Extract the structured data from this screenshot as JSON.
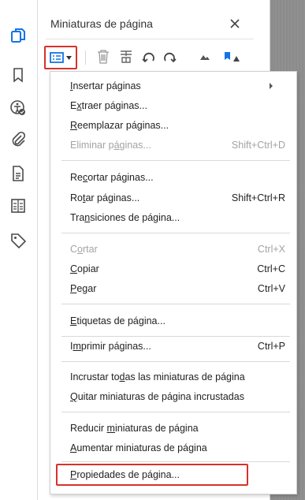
{
  "panel": {
    "title": "Miniaturas de página"
  },
  "rail": {
    "icons": [
      "page-thumbnails-icon",
      "bookmark-icon",
      "accessibility-icon",
      "attachment-icon",
      "document-icon",
      "compare-icon",
      "tag-icon"
    ]
  },
  "toolbar": {
    "icons": [
      "options-icon",
      "chevron-down-icon",
      "trash-icon",
      "insert-pages-icon",
      "rotate-left-icon",
      "rotate-right-icon",
      "small-thumbnail-icon",
      "large-thumbnail-icon"
    ]
  },
  "menu": {
    "items": [
      {
        "label": "Insertar páginas",
        "mnemonic": "I",
        "shortcut": "",
        "enabled": true,
        "submenu": true
      },
      {
        "label": "Extraer páginas...",
        "mnemonic": "x",
        "shortcut": "",
        "enabled": true,
        "submenu": false
      },
      {
        "label": "Reemplazar páginas...",
        "mnemonic": "R",
        "shortcut": "",
        "enabled": true,
        "submenu": false
      },
      {
        "label": "Eliminar páginas...",
        "mnemonic": "á",
        "shortcut": "Shift+Ctrl+D",
        "enabled": false,
        "submenu": false
      },
      {
        "label": "Recortar páginas...",
        "mnemonic": "c",
        "shortcut": "",
        "enabled": true,
        "submenu": false
      },
      {
        "label": "Rotar páginas...",
        "mnemonic": "t",
        "shortcut": "Shift+Ctrl+R",
        "enabled": true,
        "submenu": false
      },
      {
        "label": "Transiciones de página...",
        "mnemonic": "n",
        "shortcut": "",
        "enabled": true,
        "submenu": false
      },
      {
        "label": "Cortar",
        "mnemonic": "o",
        "shortcut": "Ctrl+X",
        "enabled": false,
        "submenu": false
      },
      {
        "label": "Copiar",
        "mnemonic": "C",
        "shortcut": "Ctrl+C",
        "enabled": true,
        "submenu": false
      },
      {
        "label": "Pegar",
        "mnemonic": "P",
        "shortcut": "Ctrl+V",
        "enabled": true,
        "submenu": false
      },
      {
        "label": "Etiquetas de página...",
        "mnemonic": "E",
        "shortcut": "",
        "enabled": true,
        "submenu": false
      },
      {
        "label": "Imprimir páginas...",
        "mnemonic": "m",
        "shortcut": "Ctrl+P",
        "enabled": true,
        "submenu": false
      },
      {
        "label": "Incrustar todas las miniaturas de página",
        "mnemonic": "d",
        "shortcut": "",
        "enabled": true,
        "submenu": false
      },
      {
        "label": "Quitar miniaturas de página incrustadas",
        "mnemonic": "Q",
        "shortcut": "",
        "enabled": true,
        "submenu": false
      },
      {
        "label": "Reducir miniaturas de página",
        "mnemonic": "m",
        "shortcut": "",
        "enabled": true,
        "submenu": false
      },
      {
        "label": "Aumentar miniaturas de página",
        "mnemonic": "A",
        "shortcut": "",
        "enabled": true,
        "submenu": false
      },
      {
        "label": "Propiedades de página...",
        "mnemonic": "P",
        "shortcut": "",
        "enabled": true,
        "submenu": false
      }
    ]
  },
  "colors": {
    "highlight": "#d9312a",
    "accent_blue": "#1473e6",
    "disabled_text": "#a3a3a3"
  }
}
